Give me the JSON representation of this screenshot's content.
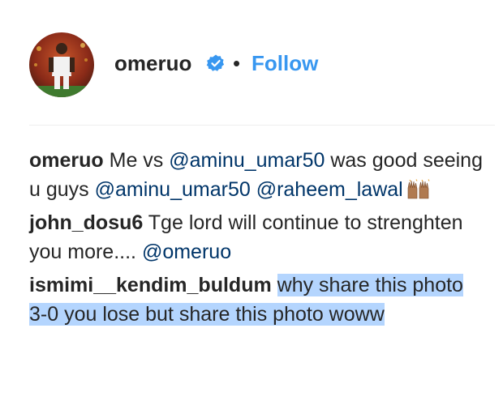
{
  "post_header": {
    "username": "omeruo",
    "verified_icon": "verified-badge-icon",
    "separator": "•",
    "follow_label": "Follow",
    "colors": {
      "link": "#3897f0",
      "mention": "#003569",
      "text": "#262626",
      "selection": "#b4d5fe"
    }
  },
  "comments": [
    {
      "author": "omeruo",
      "segments": [
        {
          "type": "text",
          "value": " Me vs "
        },
        {
          "type": "mention",
          "value": "@aminu_umar50"
        },
        {
          "type": "text",
          "value": " was good seeing u guys "
        },
        {
          "type": "mention",
          "value": "@aminu_umar50"
        },
        {
          "type": "text",
          "value": " "
        },
        {
          "type": "mention",
          "value": "@raheem_lawal"
        },
        {
          "type": "emoji",
          "value": "raised-hands-emoji"
        }
      ]
    },
    {
      "author": "john_dosu6",
      "segments": [
        {
          "type": "text",
          "value": " Tge lord will continue to strenghten you more.... "
        },
        {
          "type": "mention",
          "value": "@omeruo"
        }
      ]
    },
    {
      "author": "ismimi__kendim_buldum",
      "segments": [
        {
          "type": "text",
          "value": " "
        },
        {
          "type": "highlight",
          "value": "why share this photo 3-0 you lose but share this photo woww"
        }
      ]
    }
  ]
}
